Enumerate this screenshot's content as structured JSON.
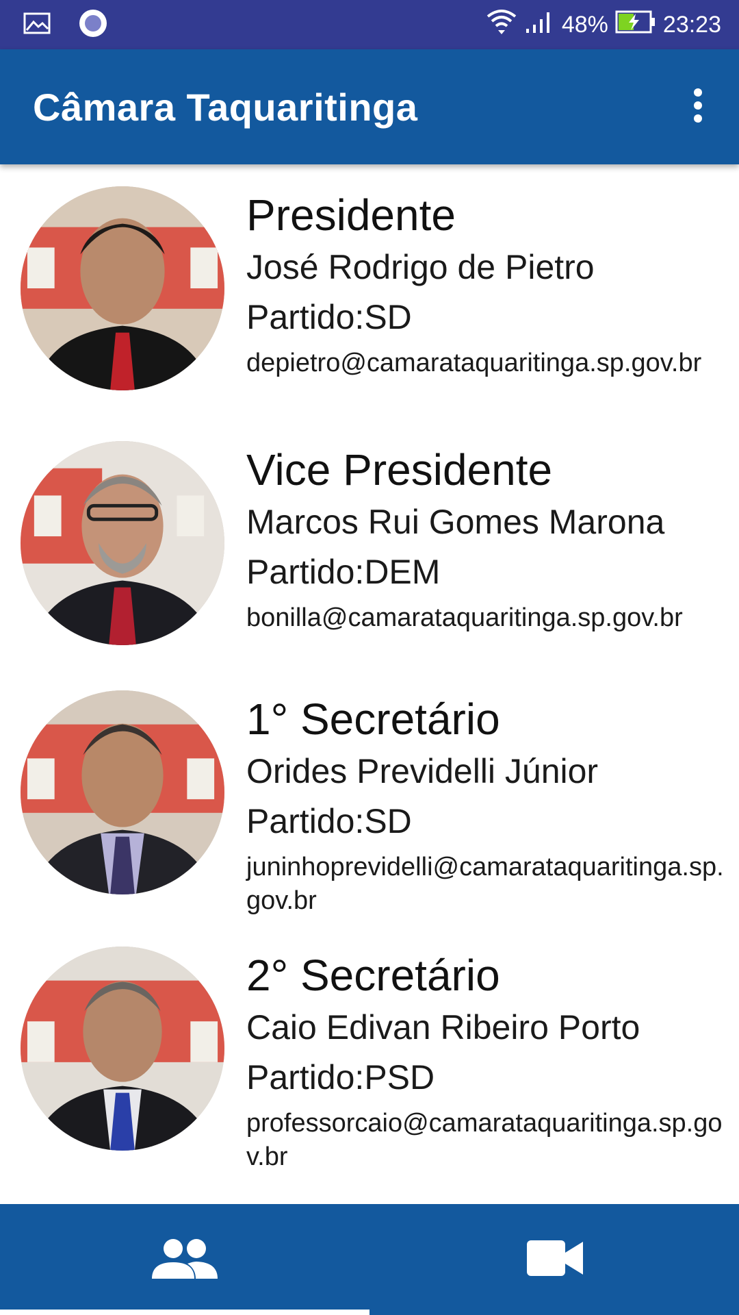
{
  "status_bar": {
    "battery": "48%",
    "time": "23:23"
  },
  "app_bar": {
    "title": "Câmara Taquaritinga"
  },
  "members": [
    {
      "role": "Presidente",
      "name": "José Rodrigo de Pietro",
      "party": "Partido:SD",
      "email": "depietro@camarataquaritinga.sp.gov.br"
    },
    {
      "role": "Vice Presidente",
      "name": "Marcos Rui Gomes Marona",
      "party": "Partido:DEM",
      "email": "bonilla@camarataquaritinga.sp.gov.br"
    },
    {
      "role": "1° Secretário",
      "name": "Orides Previdelli Júnior",
      "party": "Partido:SD",
      "email": "juninhoprevidelli@camarataquaritinga.sp.gov.br"
    },
    {
      "role": "2° Secretário",
      "name": "Caio Edivan Ribeiro Porto",
      "party": "Partido:PSD",
      "email": "professorcaio@camarataquaritinga.sp.gov.br"
    }
  ],
  "bottom_nav": {
    "tabs": [
      {
        "icon": "people-icon",
        "selected": true
      },
      {
        "icon": "video-camera-icon",
        "selected": false
      }
    ]
  },
  "colors": {
    "status_bar": "#333b91",
    "app_bar": "#13599e",
    "bottom_nav": "#13599e"
  }
}
